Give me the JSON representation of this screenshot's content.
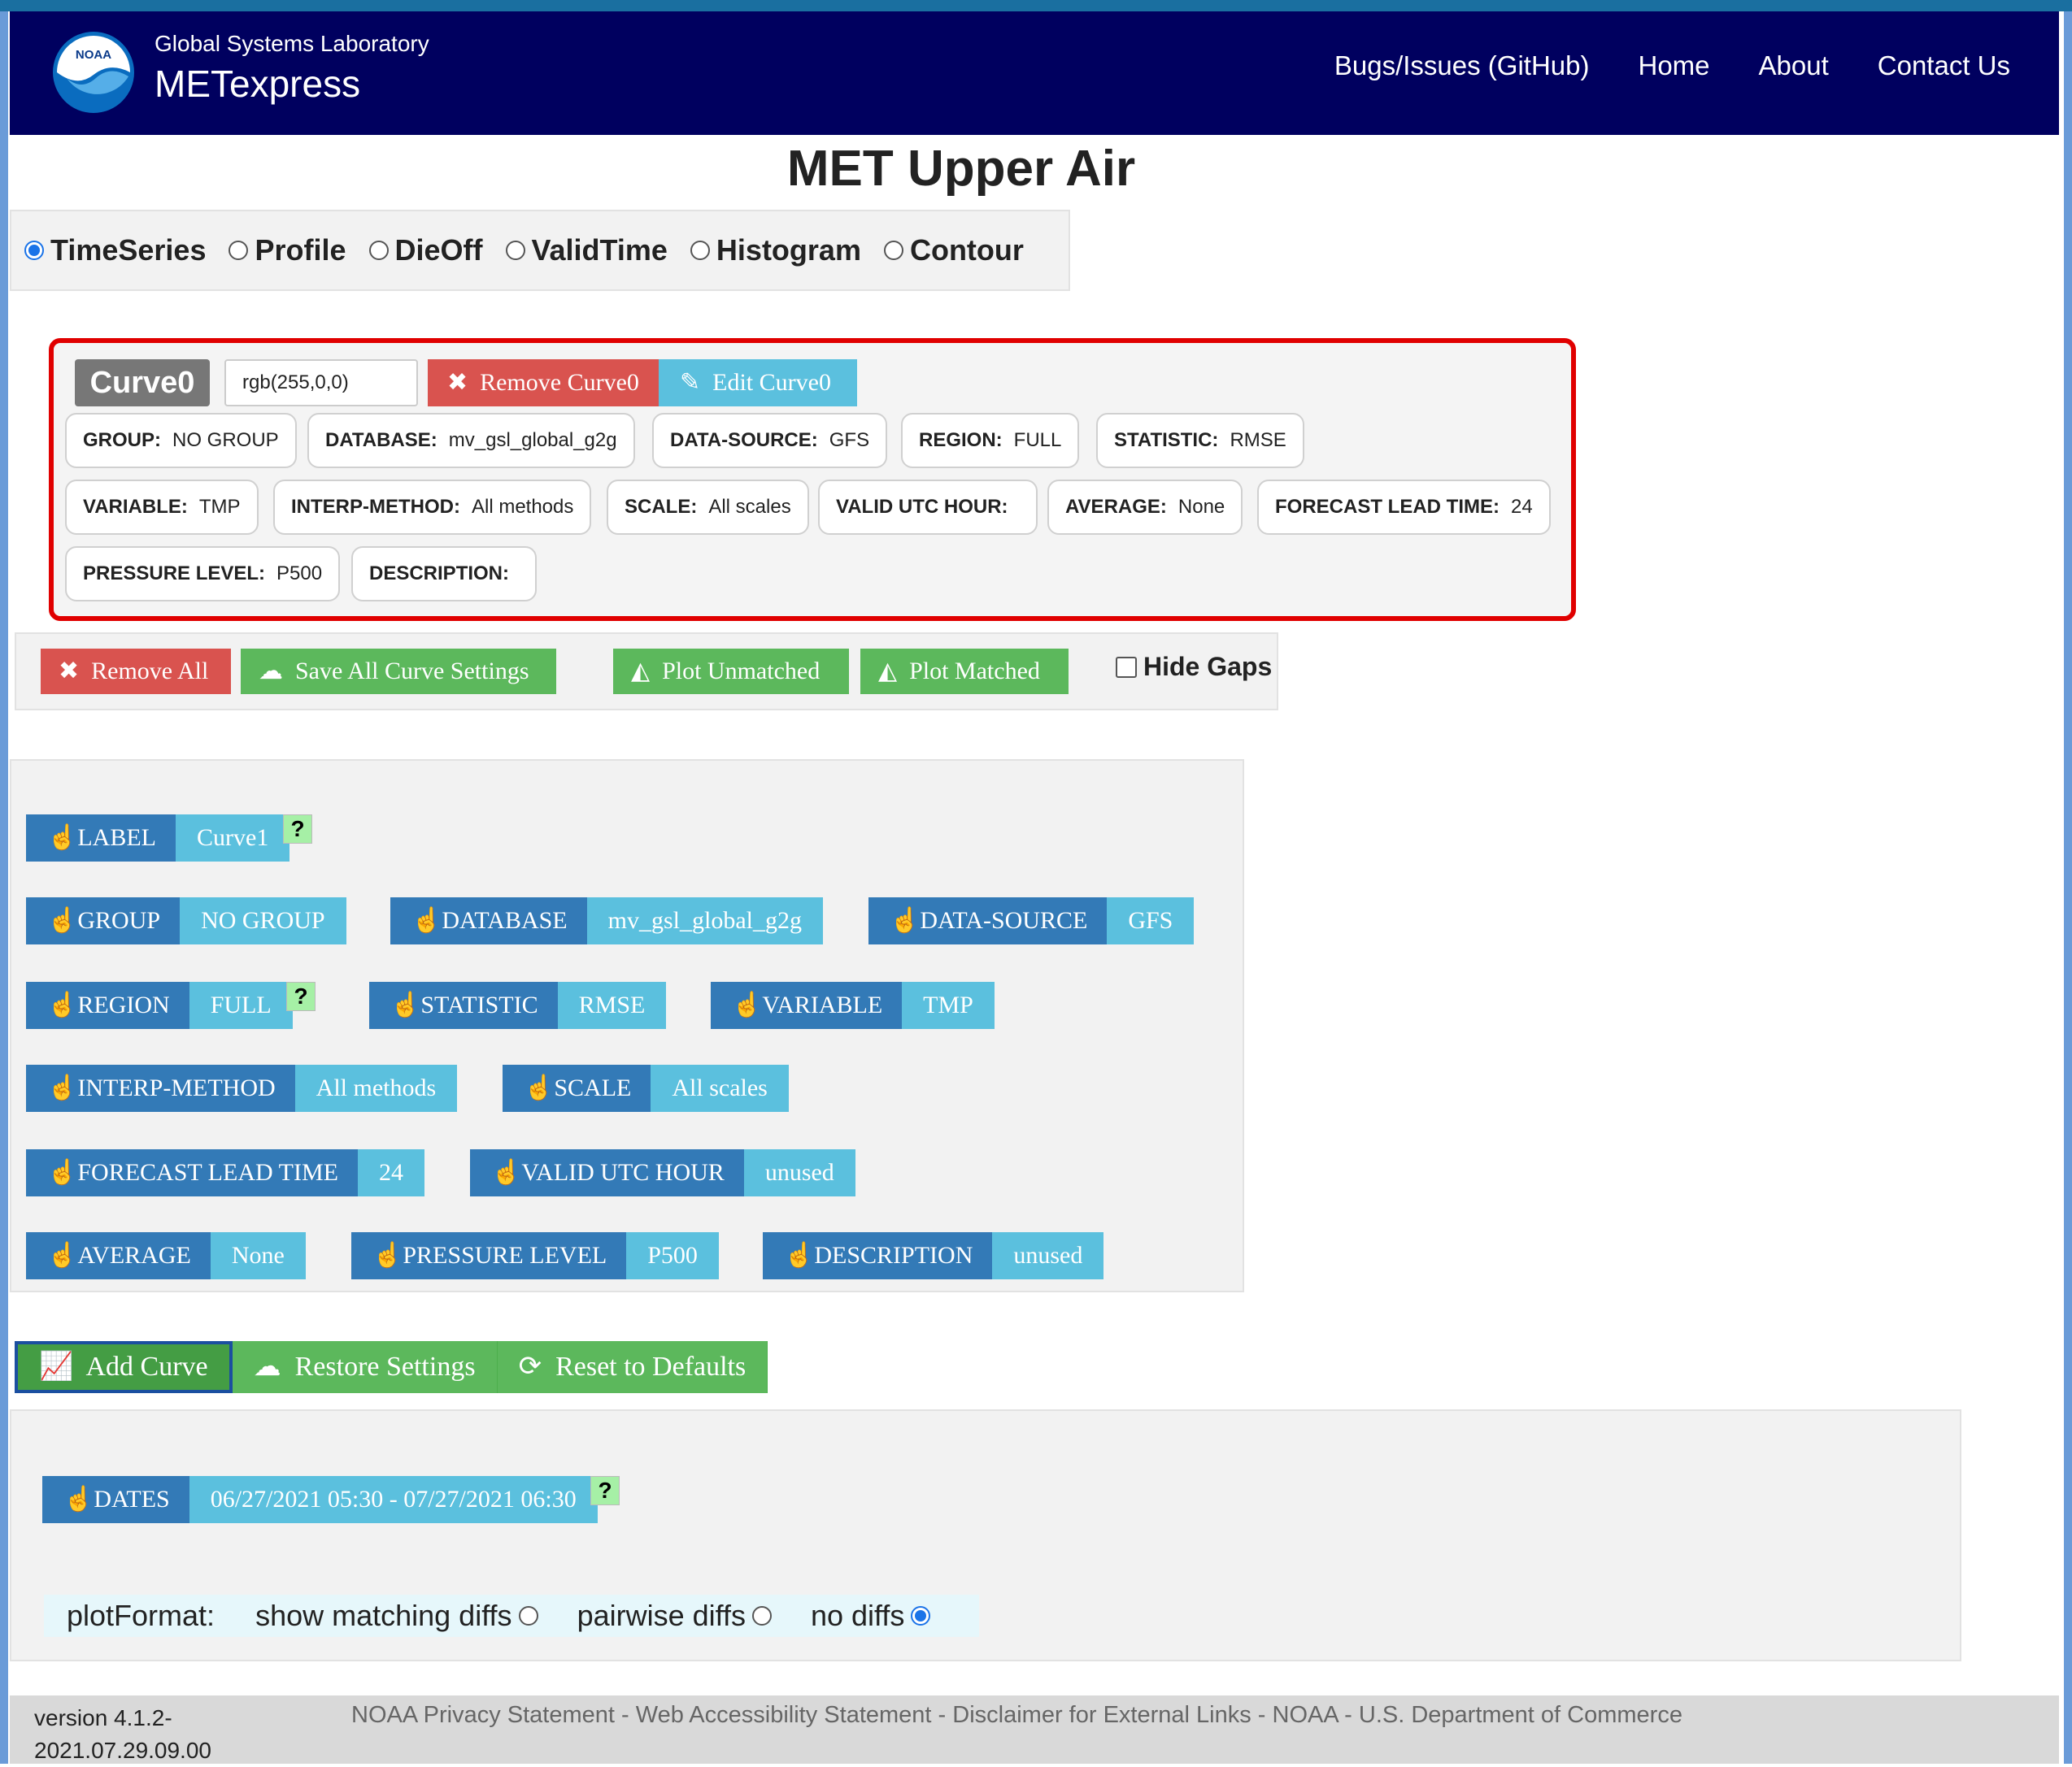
{
  "navbar": {
    "subtitle": "Global Systems Laboratory",
    "title": "METexpress",
    "logo_text": "NOAA",
    "links": [
      "Bugs/Issues (GitHub)",
      "Home",
      "About",
      "Contact Us"
    ]
  },
  "page_title": "MET Upper Air",
  "plot_types": {
    "options": [
      "TimeSeries",
      "Profile",
      "DieOff",
      "ValidTime",
      "Histogram",
      "Contour"
    ],
    "selected": "TimeSeries"
  },
  "curve0": {
    "label": "Curve0",
    "color": "rgb(255,0,0)",
    "remove_label": "Remove Curve0",
    "edit_label": "Edit Curve0",
    "params": [
      {
        "key": "GROUP:",
        "value": "NO GROUP"
      },
      {
        "key": "DATABASE:",
        "value": "mv_gsl_global_g2g"
      },
      {
        "key": "DATA-SOURCE:",
        "value": "GFS"
      },
      {
        "key": "REGION:",
        "value": "FULL"
      },
      {
        "key": "STATISTIC:",
        "value": "RMSE"
      },
      {
        "key": "VARIABLE:",
        "value": "TMP"
      },
      {
        "key": "INTERP-METHOD:",
        "value": "All methods"
      },
      {
        "key": "SCALE:",
        "value": "All scales"
      },
      {
        "key": "VALID UTC HOUR:",
        "value": ""
      },
      {
        "key": "AVERAGE:",
        "value": "None"
      },
      {
        "key": "FORECAST LEAD TIME:",
        "value": "24"
      },
      {
        "key": "PRESSURE LEVEL:",
        "value": "P500"
      },
      {
        "key": "DESCRIPTION:",
        "value": ""
      }
    ]
  },
  "actions": {
    "remove_all": "Remove All",
    "save_all": "Save All Curve Settings",
    "plot_unmatched": "Plot Unmatched",
    "plot_matched": "Plot Matched",
    "hide_gaps": "Hide Gaps",
    "hide_gaps_checked": false
  },
  "selectors": {
    "label": {
      "key": "LABEL",
      "value": "Curve1"
    },
    "group": {
      "key": "GROUP",
      "value": "NO GROUP"
    },
    "database": {
      "key": "DATABASE",
      "value": "mv_gsl_global_g2g"
    },
    "data_source": {
      "key": "DATA-SOURCE",
      "value": "GFS"
    },
    "region": {
      "key": "REGION",
      "value": "FULL"
    },
    "statistic": {
      "key": "STATISTIC",
      "value": "RMSE"
    },
    "variable": {
      "key": "VARIABLE",
      "value": "TMP"
    },
    "interp_method": {
      "key": "INTERP-METHOD",
      "value": "All methods"
    },
    "scale": {
      "key": "SCALE",
      "value": "All scales"
    },
    "forecast_lead_time": {
      "key": "FORECAST LEAD TIME",
      "value": "24"
    },
    "valid_utc_hour": {
      "key": "VALID UTC HOUR",
      "value": "unused"
    },
    "average": {
      "key": "AVERAGE",
      "value": "None"
    },
    "pressure_level": {
      "key": "PRESSURE LEVEL",
      "value": "P500"
    },
    "description": {
      "key": "DESCRIPTION",
      "value": "unused"
    },
    "help": "?"
  },
  "curve_actions": {
    "add_curve": "Add Curve",
    "restore_settings": "Restore Settings",
    "reset_defaults": "Reset to Defaults"
  },
  "dates": {
    "key": "DATES",
    "value": "06/27/2021 05:30 - 07/27/2021 06:30"
  },
  "plot_format": {
    "label": "plotFormat:",
    "options": [
      "show matching diffs",
      "pairwise diffs",
      "no diffs"
    ],
    "selected": "no diffs"
  },
  "footer": {
    "version": "version 4.1.2-2021.07.29.09.00",
    "links": [
      "NOAA Privacy Statement",
      "Web Accessibility Statement",
      "Disclaimer for External Links",
      "NOAA",
      "U.S. Department of Commerce"
    ],
    "separator": " - "
  },
  "colors": {
    "navbar": "#00005f",
    "primary": "#337ab7",
    "info": "#5bc0de",
    "success": "#5cb85c",
    "danger": "#d9534f",
    "highlight_border": "#e00000"
  }
}
